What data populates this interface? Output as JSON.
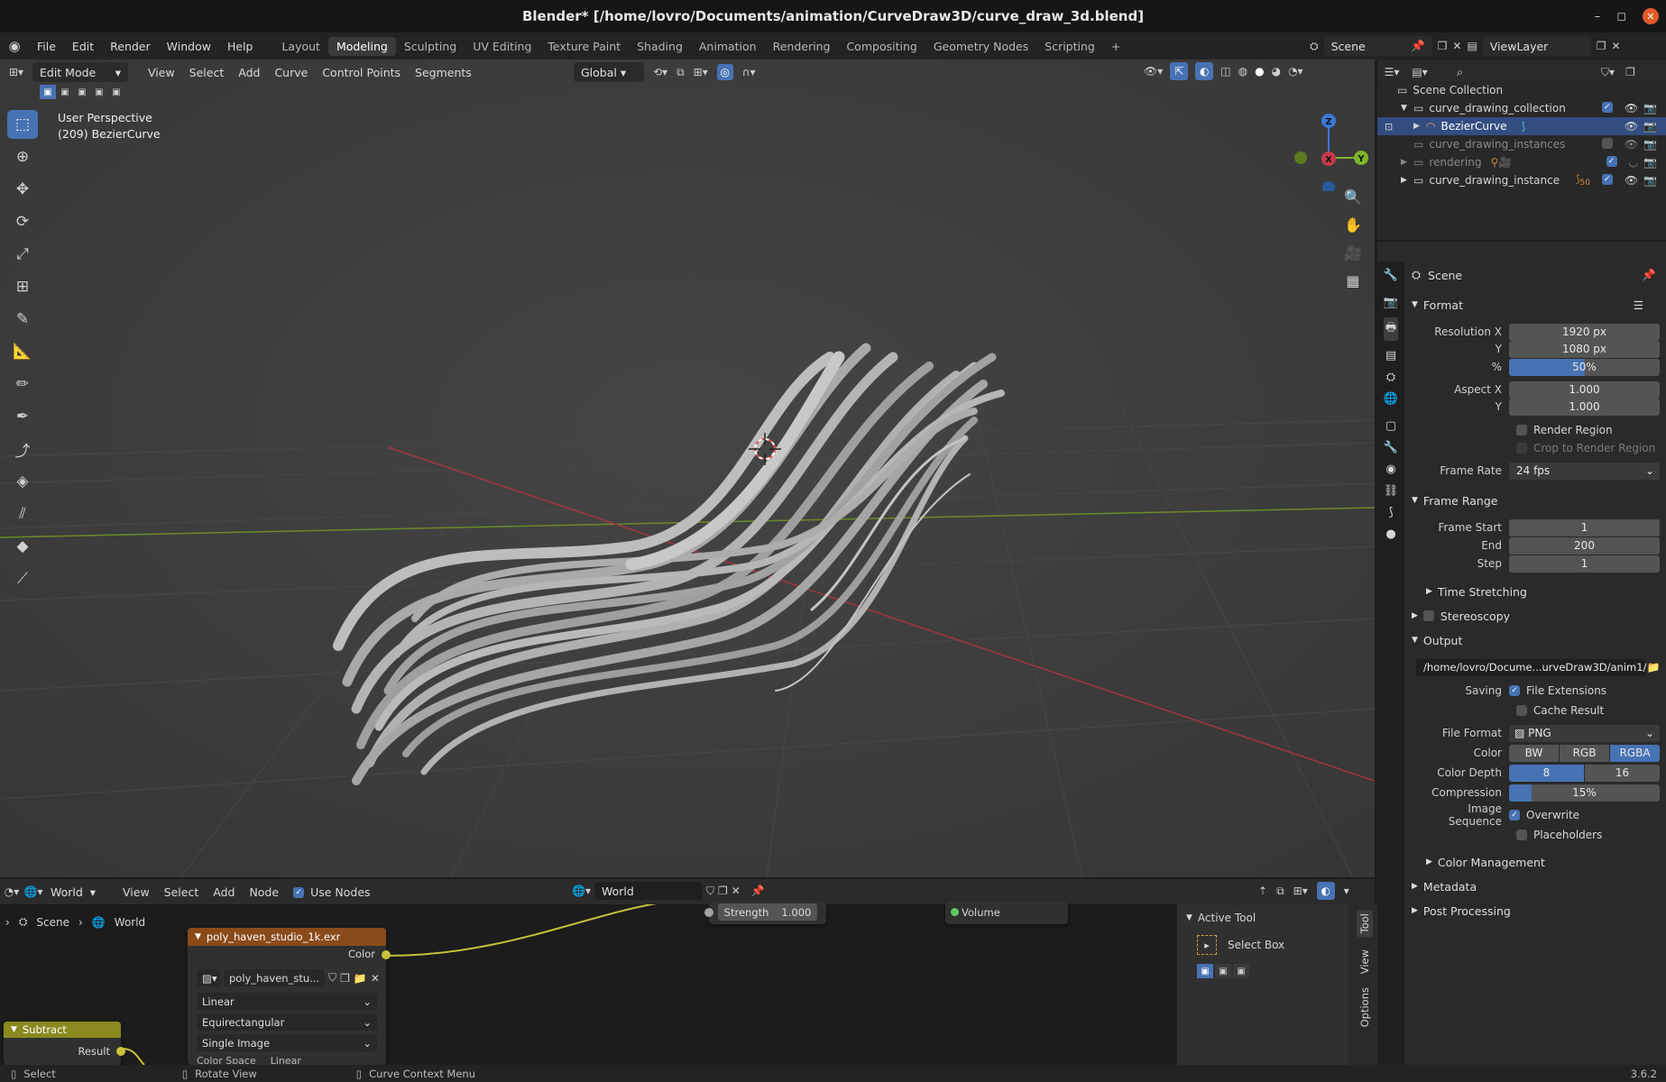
{
  "window": {
    "title": "Blender* [/home/lovro/Documents/animation/CurveDraw3D/curve_draw_3d.blend]"
  },
  "menu": [
    "File",
    "Edit",
    "Render",
    "Window",
    "Help"
  ],
  "workspaces": [
    "Layout",
    "Modeling",
    "Sculpting",
    "UV Editing",
    "Texture Paint",
    "Shading",
    "Animation",
    "Rendering",
    "Compositing",
    "Geometry Nodes",
    "Scripting"
  ],
  "active_workspace": "Modeling",
  "scene_name": "Scene",
  "viewlayer_name": "ViewLayer",
  "viewport_header": {
    "mode": "Edit Mode",
    "menus": [
      "View",
      "Select",
      "Add",
      "Curve",
      "Control Points",
      "Segments"
    ],
    "orientation": "Global"
  },
  "viewport": {
    "perspective": "User Perspective",
    "object": "(209) BezierCurve",
    "gizmo": {
      "z": "Z",
      "x": "X",
      "y": "Y"
    }
  },
  "outliner": {
    "root": "Scene Collection",
    "items": [
      {
        "label": "curve_drawing_collection",
        "dim": false
      },
      {
        "label": "BezierCurve",
        "dim": false,
        "selected": true
      },
      {
        "label": "curve_drawing_instances",
        "dim": true
      },
      {
        "label": "rendering",
        "dim": true
      },
      {
        "label": "curve_drawing_instance",
        "dim": false,
        "badge": "50"
      }
    ]
  },
  "properties": {
    "context": "Scene",
    "format": {
      "title": "Format",
      "resolution_x_label": "Resolution X",
      "resolution_x": "1920 px",
      "y_label": "Y",
      "resolution_y": "1080 px",
      "pct_label": "%",
      "percent": "50%",
      "percent_value": 0.5,
      "aspect_x_label": "Aspect X",
      "aspect_x": "1.000",
      "aspect_y_label": "Y",
      "aspect_y": "1.000",
      "render_region": "Render Region",
      "crop": "Crop to Render Region",
      "frame_rate_label": "Frame Rate",
      "frame_rate": "24 fps"
    },
    "frame_range": {
      "title": "Frame Range",
      "start_label": "Frame Start",
      "start": "1",
      "end_label": "End",
      "end": "200",
      "step_label": "Step",
      "step": "1",
      "time_stretching": "Time Stretching"
    },
    "stereoscopy": "Stereoscopy",
    "output": {
      "title": "Output",
      "path": "/home/lovro/Docume...urveDraw3D/anim1/",
      "saving_label": "Saving",
      "file_extensions": "File Extensions",
      "cache_result": "Cache Result",
      "file_format_label": "File Format",
      "file_format": "PNG",
      "color_label": "Color",
      "color_options": [
        "BW",
        "RGB",
        "RGBA"
      ],
      "color_selected": "RGBA",
      "depth_label": "Color Depth",
      "depth_options": [
        "8",
        "16"
      ],
      "depth_selected": "8",
      "compression_label": "Compression",
      "compression": "15%",
      "compression_value": 0.15,
      "image_seq_label": "Image Sequence",
      "overwrite": "Overwrite",
      "placeholders": "Placeholders",
      "color_management": "Color Management"
    },
    "metadata": "Metadata",
    "post_processing": "Post Processing"
  },
  "node_editor": {
    "type": "World",
    "menus": [
      "View",
      "Select",
      "Add",
      "Node"
    ],
    "use_nodes": "Use Nodes",
    "world_field": "World",
    "breadcrumb": [
      "Scene",
      "World"
    ],
    "image_node": {
      "title": "poly_haven_studio_1k.exr",
      "output": "Color",
      "image": "poly_haven_stu...",
      "interp": "Linear",
      "proj": "Equirectangular",
      "source": "Single Image",
      "colorspace_label": "Color Space",
      "colorspace": "Linear"
    },
    "strength_label": "Strength",
    "strength": "1.000",
    "volume": "Volume",
    "subtract": {
      "title": "Subtract",
      "output": "Result"
    },
    "sidebar": {
      "panel": "Active Tool",
      "tool": "Select Box",
      "tabs": [
        "Tool",
        "View",
        "Options"
      ]
    }
  },
  "status": {
    "left": "Select",
    "mid": "Rotate View",
    "right": "Curve Context Menu",
    "version": "3.6.2"
  },
  "colors": {
    "accent": "#4772b3",
    "node_header_image": "#8a4a1a",
    "node_header_subtract": "#8a8a20",
    "x_axis": "#c83a4a",
    "y_axis": "#7fb52a",
    "z_axis": "#3a78d8"
  }
}
